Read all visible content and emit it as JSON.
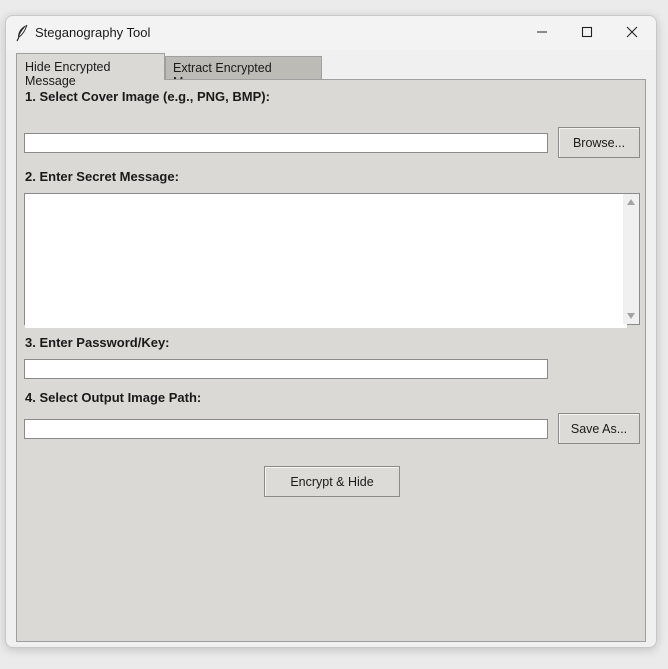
{
  "window": {
    "title": "Steganography Tool",
    "icon": "feather-icon",
    "controls": [
      "minimize-icon",
      "maximize-icon",
      "close-icon"
    ]
  },
  "tabs": [
    {
      "label": "Hide Encrypted Message",
      "active": true
    },
    {
      "label": "Extract Encrypted Message",
      "active": false
    }
  ],
  "form": {
    "cover_label": "1. Select Cover Image (e.g., PNG, BMP):",
    "cover_value": "",
    "browse_label": "Browse...",
    "message_label": "2. Enter Secret Message:",
    "message_value": "",
    "password_label": "3. Enter Password/Key:",
    "password_value": "",
    "output_label": "4. Select Output Image Path:",
    "output_value": "",
    "save_as_label": "Save As...",
    "submit_label": "Encrypt & Hide"
  }
}
